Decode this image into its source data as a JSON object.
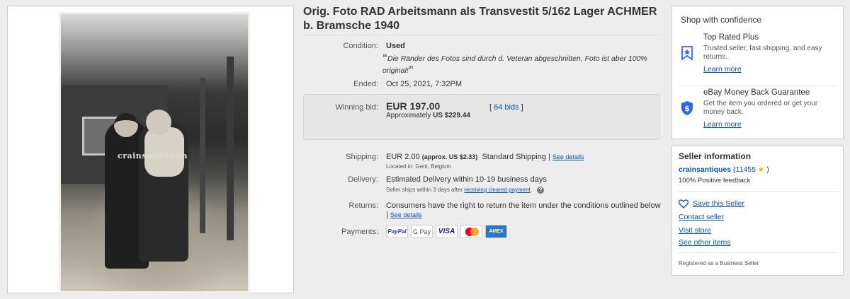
{
  "listing": {
    "title": "Orig. Foto RAD Arbeitsmann als Transvestit 5/162 Lager ACHMER b. Bramsche 1940",
    "photo_watermark": "crainsmilitaria"
  },
  "details": {
    "condition_label": "Condition:",
    "condition_value": "Used",
    "condition_quote": "Die Ränder des Fotos sind durch d. Veteran abgeschnitten, Foto ist aber 100% original!",
    "quote_open": "“",
    "quote_close": "”",
    "ended_label": "Ended:",
    "ended_value": "Oct 25, 2021, 7:32PM",
    "winning_bid_label": "Winning bid:",
    "winning_bid_value": "EUR 197.00",
    "approx_prefix": "Approximately",
    "approx_value": "US $229.44",
    "bids_open": "[",
    "bids_count": "64 bids",
    "bids_close": "]",
    "shipping_label": "Shipping:",
    "shipping_value": "EUR 2.00",
    "shipping_approx": "(approx. US $2.33)",
    "shipping_method": "Standard Shipping",
    "shipping_sep": "|",
    "shipping_details": "See details",
    "located_in": "Located in:  Gent, Belgium",
    "delivery_label": "Delivery:",
    "delivery_value": "Estimated Delivery within 10-19 business days",
    "delivery_note": "Seller ships within 3 days after",
    "delivery_link": "receiving cleared payment",
    "delivery_note_end": ".",
    "help_glyph": "?",
    "returns_label": "Returns:",
    "returns_value": "Consumers have the right to return the item under the conditions outlined below",
    "returns_sep": "|",
    "returns_details": "See details",
    "payments_label": "Payments:",
    "payments": [
      "PayPal",
      "G Pay",
      "VISA",
      "",
      "AMEX"
    ]
  },
  "confidence": {
    "title": "Shop with confidence",
    "items": [
      {
        "title": "Top Rated Plus",
        "desc": "Trusted seller, fast shipping, and easy returns.",
        "link": "Learn more",
        "icon": "top-rated-badge-icon"
      },
      {
        "title": "eBay Money Back Guarantee",
        "desc": "Get the item you ordered or get your money back.",
        "link": "Learn more",
        "icon": "money-back-shield-icon"
      }
    ]
  },
  "seller": {
    "title": "Seller information",
    "name": "crainsantiques",
    "feedback_open": "(",
    "feedback_count": "11455",
    "feedback_close": ")",
    "star": "★",
    "positive": "100% Positive feedback",
    "save": "Save this Seller",
    "contact": "Contact seller",
    "store": "Visit store",
    "other": "See other items",
    "registered": "Registered as a Business Seller"
  },
  "colors": {
    "link": "#0654ba",
    "star": "#f5af02",
    "background": "#ededed"
  }
}
